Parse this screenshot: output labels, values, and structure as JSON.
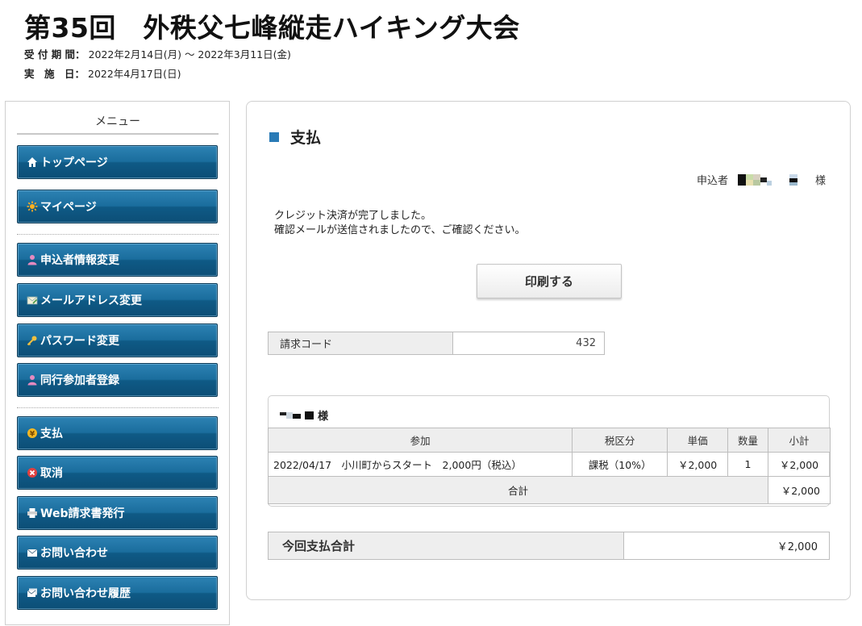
{
  "header": {
    "title": "第35回　外秩父七峰縦走ハイキング大会",
    "reception_label": "受 付 期 間：",
    "reception_value": "2022年2月14日(月) 〜 2022年3月11日(金)",
    "date_label": "実　施　日：",
    "date_value": "2022年4月17日(日)"
  },
  "sidebar": {
    "title": "メニュー",
    "items": [
      {
        "label": "トップページ",
        "icon": "home-icon"
      },
      {
        "label": "マイページ",
        "icon": "sun-icon"
      },
      {
        "label": "申込者情報変更",
        "icon": "user-icon"
      },
      {
        "label": "メールアドレス変更",
        "icon": "mail-edit-icon"
      },
      {
        "label": "パスワード変更",
        "icon": "key-icon"
      },
      {
        "label": "同行参加者登録",
        "icon": "user-icon"
      },
      {
        "label": "支払",
        "icon": "yen-coin-icon"
      },
      {
        "label": "取消",
        "icon": "cancel-icon"
      },
      {
        "label": "Web請求書発行",
        "icon": "printer-icon"
      },
      {
        "label": "お問い合わせ",
        "icon": "envelope-icon"
      },
      {
        "label": "お問い合わせ履歴",
        "icon": "envelope-history-icon"
      }
    ]
  },
  "main": {
    "section_title": "支払",
    "applicant_label": "申込者",
    "applicant_suffix": "様",
    "message_line1": "クレジット決済が完了しました。",
    "message_line2": "確認メールが送信されましたので、ご確認ください。",
    "print_button": "印刷する",
    "billing_code_label": "請求コード",
    "billing_code_value": "432",
    "order": {
      "name_suffix": "様",
      "headers": [
        "参加",
        "税区分",
        "単価",
        "数量",
        "小計"
      ],
      "row": {
        "item": "2022/04/17　小川町からスタート　2,000円（税込）",
        "tax": "課税（10%）",
        "unit_price": "￥2,000",
        "qty": "1",
        "subtotal": "￥2,000"
      },
      "total_label": "合計",
      "total_value": "￥2,000"
    },
    "grand_total_label": "今回支払合計",
    "grand_total_value": "￥2,000"
  },
  "colors": {
    "menu_button": "#1a6d9d",
    "section_square": "#2a7bb6"
  }
}
